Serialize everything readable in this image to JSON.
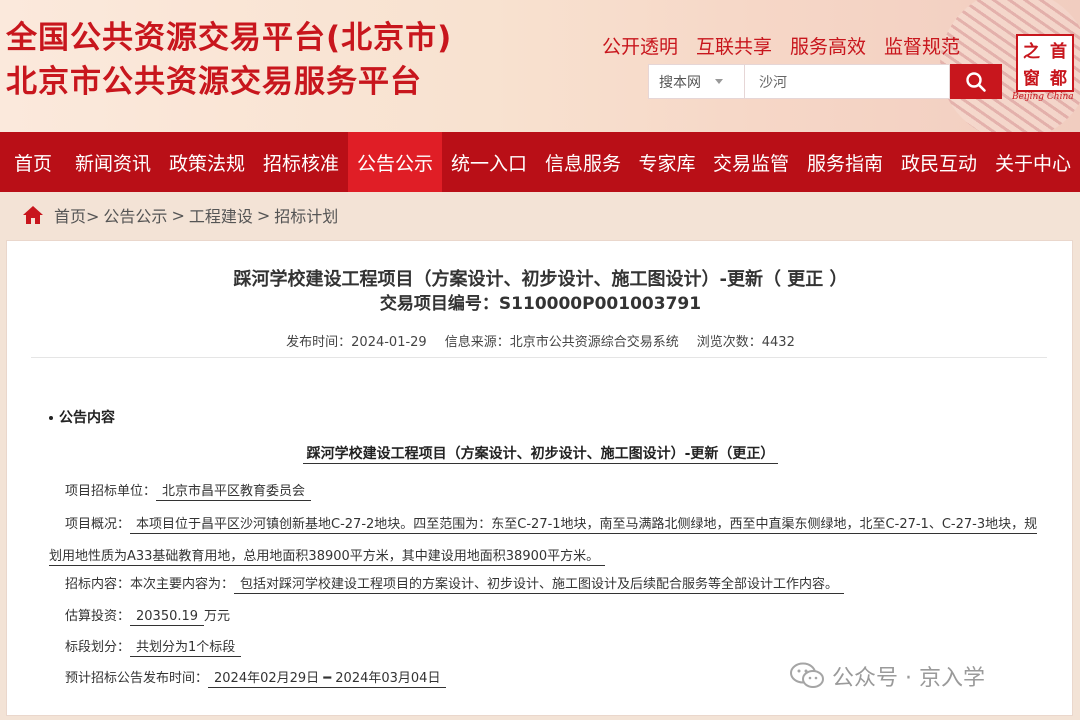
{
  "header": {
    "title_line1": "全国公共资源交易平台(北京市)",
    "title_line2": "北京市公共资源交易服务平台",
    "slogans": [
      "公开透明",
      "互联共享",
      "服务高效",
      "监督规范"
    ],
    "search": {
      "scope": "搜本网",
      "value": "沙河"
    },
    "logo": {
      "chars": [
        "之",
        "首",
        "窗",
        "都"
      ],
      "subtitle": "Beijing China"
    }
  },
  "nav": {
    "items": [
      "首页",
      "新闻资讯",
      "政策法规",
      "招标核准",
      "公告公示",
      "统一入口",
      "信息服务",
      "专家库",
      "交易监管",
      "服务指南",
      "政民互动",
      "关于中心"
    ],
    "active_index": 4
  },
  "breadcrumb": [
    "首页>",
    "公告公示",
    ">",
    "工程建设",
    ">",
    "招标计划"
  ],
  "article": {
    "title": "踩河学校建设工程项目（方案设计、初步设计、施工图设计）-更新（ 更正 ）",
    "code_label": "交易项目编号：",
    "code": "S110000P001003791",
    "publish_label": "发布时间：",
    "publish_date": "2024-01-29",
    "source_label": "信息来源：",
    "source": "北京市公共资源综合交易系统",
    "views_label": "浏览次数：",
    "views": "4432",
    "section": "公告内容",
    "notice_title": "踩河学校建设工程项目（方案设计、初步设计、施工图设计）-更新（更正）",
    "unit_label": "项目招标单位：",
    "unit": "北京市昌平区教育委员会",
    "overview_label": "项目概况：",
    "overview": "本项目位于昌平区沙河镇创新基地C-27-2地块。四至范围为：东至C-27-1地块，南至马满路北侧绿地，西至中直渠东侧绿地，北至C-27-1、C-27-3地块，规划用地性质为A33基础教育用地，总用地面积38900平方米，其中建设用地面积38900平方米。",
    "content_label": "招标内容：本次主要内容为：",
    "content": "包括对踩河学校建设工程项目的方案设计、初步设计、施工图设计及后续配合服务等全部设计工作内容。",
    "investment_label": "估算投资：",
    "investment": "20350.19",
    "investment_unit": "万元",
    "lots_label": "标段划分：",
    "lots": "共划分为1个标段",
    "time_label": "预计招标公告发布时间：",
    "time": "2024年02月29日 ━ 2024年03月04日"
  },
  "watermark": "公众号 · 京入学"
}
